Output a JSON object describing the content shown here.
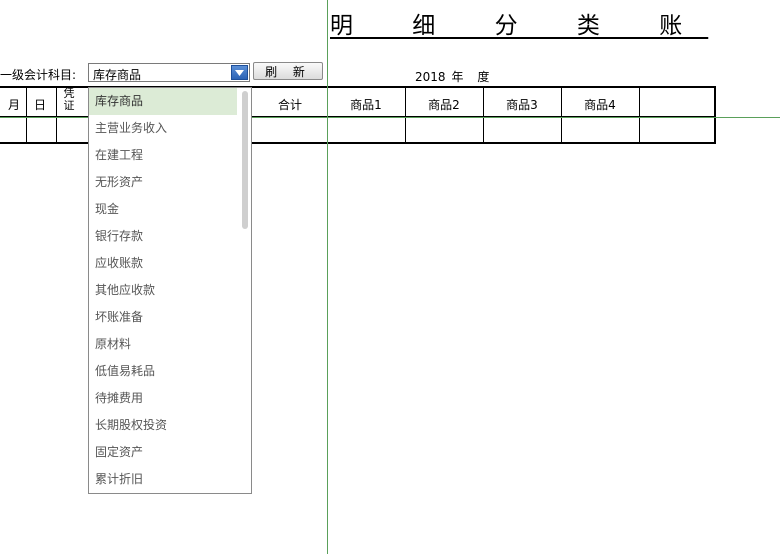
{
  "title": "明 细 分 类 账",
  "filter": {
    "label": "一级会计科目:",
    "selected": "库存商品",
    "refresh_label": "刷 新"
  },
  "year": {
    "value": "2018",
    "suffix": "年 度"
  },
  "table": {
    "headers": {
      "month": "月",
      "day": "日",
      "voucher": "凭证",
      "total": "合计",
      "p1": "商品1",
      "p2": "商品2",
      "p3": "商品3",
      "p4": "商品4"
    }
  },
  "dropdown": {
    "options": [
      "库存商品",
      "主营业务收入",
      "在建工程",
      "无形资产",
      "现金",
      "银行存款",
      "应收账款",
      "其他应收款",
      "坏账准备",
      "原材料",
      "低值易耗品",
      "待摊费用",
      "长期股权投资",
      "固定资产",
      "累计折旧"
    ]
  },
  "colors": {
    "guide": "#5aa05a",
    "selected_row": "#dcebd6",
    "combo_arrow": "#2c63b5"
  }
}
